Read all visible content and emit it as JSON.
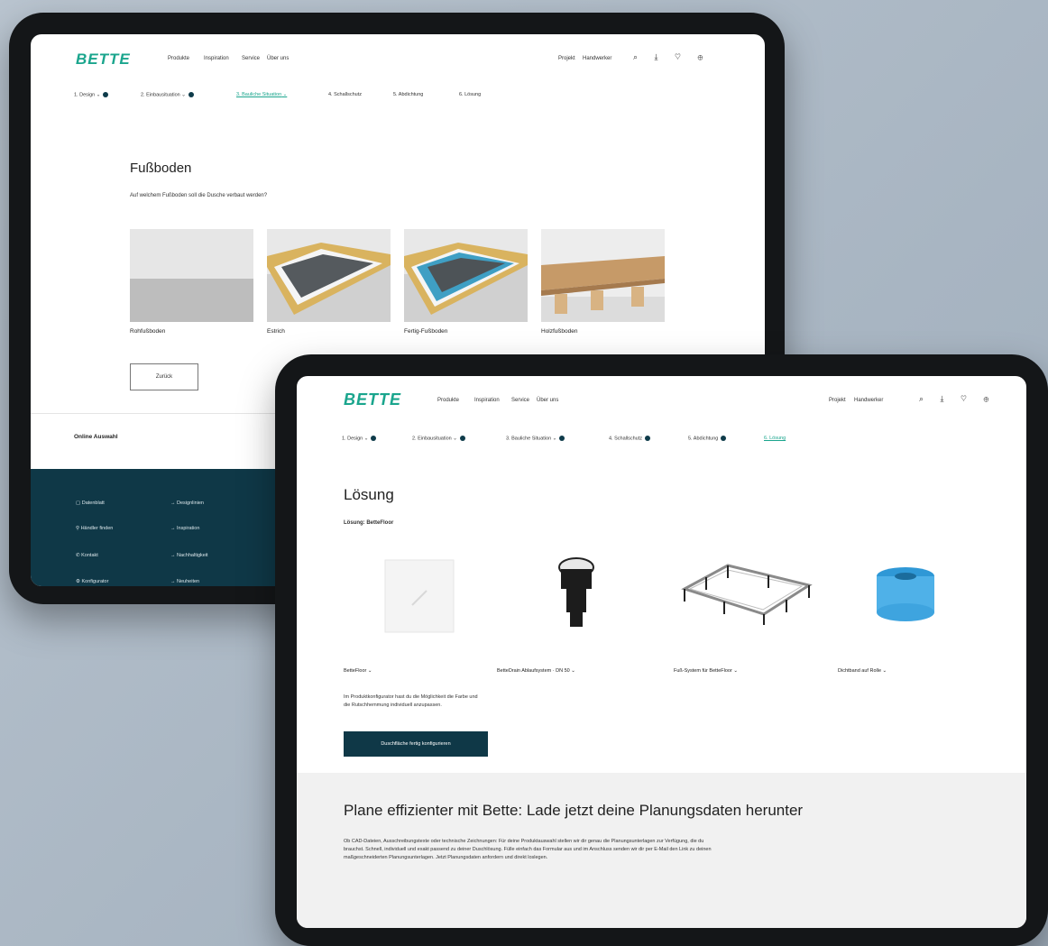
{
  "brand": {
    "logo": "BETTE",
    "accent": "#1aa58d",
    "dark": "#0f3847"
  },
  "nav": {
    "items": [
      "Produkte",
      "Inspiration",
      "Service",
      "Über uns"
    ],
    "right_items": [
      "Projekt",
      "Handwerker"
    ],
    "icons": [
      "search-icon",
      "download-icon",
      "heart-icon",
      "globe-icon"
    ],
    "icon_glyphs": "⌕ ⤓ ♡ ⊕"
  },
  "back_tablet": {
    "steps": [
      {
        "label": "1. Design",
        "done": true
      },
      {
        "label": "2. Einbausituation",
        "done": true
      },
      {
        "label": "3. Bauliche Situation",
        "active": true
      },
      {
        "label": "4. Schallschutz"
      },
      {
        "label": "5. Abdichtung"
      },
      {
        "label": "6. Lösung"
      }
    ],
    "title": "Fußboden",
    "question": "Auf welchem Fußboden soll die Dusche verbaut werden?",
    "options": [
      "Rohfußboden",
      "Estrich",
      "Fertig-Fußboden",
      "Holzfußboden"
    ],
    "back_button": "Zurück",
    "footer_title": "Online Auswahl",
    "footer_links_left": [
      "Datenblatt",
      "Händler finden",
      "Kontakt",
      "Konfigurator"
    ],
    "footer_links_right": [
      "Designlinien",
      "Inspiration",
      "Nachhaltigkeit",
      "Neuheiten"
    ]
  },
  "front_tablet": {
    "steps": [
      {
        "label": "1. Design",
        "done": true
      },
      {
        "label": "2. Einbausituation",
        "done": true
      },
      {
        "label": "3. Bauliche Situation",
        "done": true
      },
      {
        "label": "4. Schallschutz",
        "done": true
      },
      {
        "label": "5. Abdichtung",
        "done": true
      },
      {
        "label": "6. Lösung",
        "active": true
      }
    ],
    "title": "Lösung",
    "subtitle": "Lösung: BetteFloor",
    "products": [
      {
        "label": "BetteFloor"
      },
      {
        "label": "BetteDrain Ablaufsystem · DN 50"
      },
      {
        "label": "Fuß-System für BetteFloor"
      },
      {
        "label": "Dichtband auf Rolle"
      }
    ],
    "description": "Im Produktkonfigurator hast du die Möglichkeit die Farbe und die Rutschhemmung individuell anzupassen.",
    "config_button": "Duschfläche fertig konfigurieren",
    "banner_title": "Plane effizienter mit Bette: Lade jetzt deine Planungsdaten herunter",
    "banner_text": "Ob CAD-Dateien, Ausschreibungstexte oder technische Zeichnungen: Für deine Produktauswahl stellen wir dir genau die Planungsunterlagen zur Verfügung, die du brauchst. Schnell, individuell und exakt passend zu deiner Duschlösung. Fülle einfach das Formular aus und im Anschluss senden wir dir per E-Mail den Link zu deinen maßgeschneiderten Planungsunterlagen. Jetzt Planungsdaten anfordern und direkt loslegen."
  }
}
